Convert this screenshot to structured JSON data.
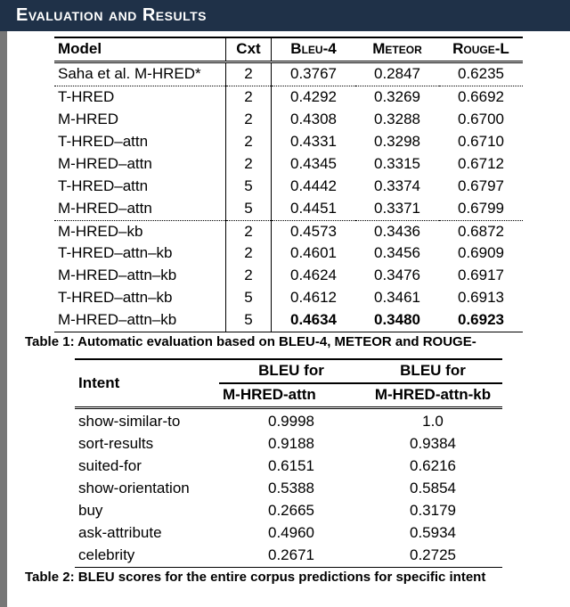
{
  "title": "Evaluation and Results",
  "table1": {
    "headers": {
      "model": "Model",
      "cxt": "Cxt",
      "bleu": "Bleu-4",
      "meteor": "Meteor",
      "rouge": "Rouge-L"
    },
    "groups": [
      [
        {
          "model": "Saha et al. M-HRED*",
          "cxt": "2",
          "bleu": "0.3767",
          "meteor": "0.2847",
          "rouge": "0.6235"
        }
      ],
      [
        {
          "model": "T-HRED",
          "cxt": "2",
          "bleu": "0.4292",
          "meteor": "0.3269",
          "rouge": "0.6692"
        },
        {
          "model": "M-HRED",
          "cxt": "2",
          "bleu": "0.4308",
          "meteor": "0.3288",
          "rouge": "0.6700"
        },
        {
          "model": "T-HRED–attn",
          "cxt": "2",
          "bleu": "0.4331",
          "meteor": "0.3298",
          "rouge": "0.6710"
        },
        {
          "model": "M-HRED–attn",
          "cxt": "2",
          "bleu": "0.4345",
          "meteor": "0.3315",
          "rouge": "0.6712"
        },
        {
          "model": "T-HRED–attn",
          "cxt": "5",
          "bleu": "0.4442",
          "meteor": "0.3374",
          "rouge": "0.6797"
        },
        {
          "model": "M-HRED–attn",
          "cxt": "5",
          "bleu": "0.4451",
          "meteor": "0.3371",
          "rouge": "0.6799"
        }
      ],
      [
        {
          "model": "M-HRED–kb",
          "cxt": "2",
          "bleu": "0.4573",
          "meteor": "0.3436",
          "rouge": "0.6872"
        },
        {
          "model": "T-HRED–attn–kb",
          "cxt": "2",
          "bleu": "0.4601",
          "meteor": "0.3456",
          "rouge": "0.6909"
        },
        {
          "model": "M-HRED–attn–kb",
          "cxt": "2",
          "bleu": "0.4624",
          "meteor": "0.3476",
          "rouge": "0.6917"
        },
        {
          "model": "T-HRED–attn–kb",
          "cxt": "5",
          "bleu": "0.4612",
          "meteor": "0.3461",
          "rouge": "0.6913"
        },
        {
          "model": "M-HRED–attn–kb",
          "cxt": "5",
          "bleu": "0.4634",
          "meteor": "0.3480",
          "rouge": "0.6923",
          "bold": true
        }
      ]
    ],
    "caption": "Table 1: Automatic evaluation based on BLEU-4, METEOR and ROUGE-"
  },
  "table2": {
    "headers": {
      "intent": "Intent",
      "c1a": "BLEU for",
      "c1b": "M-HRED-attn",
      "c2a": "BLEU for",
      "c2b": "M-HRED-attn-kb"
    },
    "rows": [
      {
        "intent": "show-similar-to",
        "c1": "0.9998",
        "c2": "1.0"
      },
      {
        "intent": "sort-results",
        "c1": "0.9188",
        "c2": "0.9384"
      },
      {
        "intent": "suited-for",
        "c1": "0.6151",
        "c2": "0.6216"
      },
      {
        "intent": "show-orientation",
        "c1": "0.5388",
        "c2": "0.5854"
      },
      {
        "intent": "buy",
        "c1": "0.2665",
        "c2": "0.3179"
      },
      {
        "intent": "ask-attribute",
        "c1": "0.4960",
        "c2": "0.5934"
      },
      {
        "intent": "celebrity",
        "c1": "0.2671",
        "c2": "0.2725"
      }
    ],
    "caption": "Table 2: BLEU scores for the entire corpus predictions for specific intent"
  }
}
